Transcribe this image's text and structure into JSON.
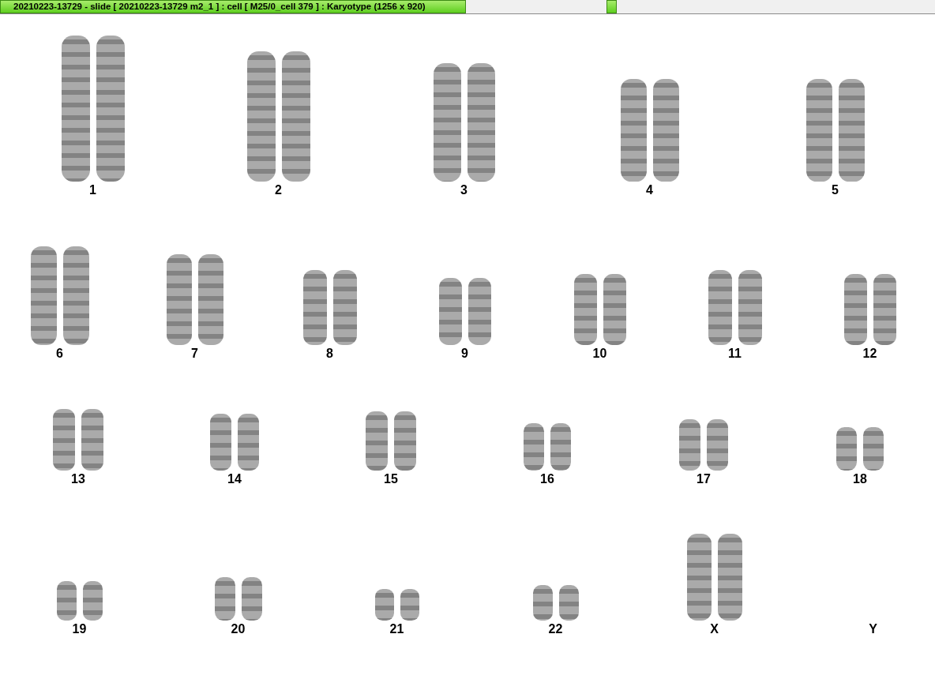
{
  "title_bar": {
    "title": "20210223-13729 - slide [ 20210223-13729 m2_1 ] : cell [ M25/0_cell 379 ] : Karyotype  (1256 x 920)"
  },
  "karyotype": {
    "chromosomes": [
      {
        "label": "1",
        "present": true
      },
      {
        "label": "2",
        "present": true
      },
      {
        "label": "3",
        "present": true
      },
      {
        "label": "4",
        "present": true
      },
      {
        "label": "5",
        "present": true
      },
      {
        "label": "6",
        "present": true
      },
      {
        "label": "7",
        "present": true
      },
      {
        "label": "8",
        "present": true
      },
      {
        "label": "9",
        "present": true
      },
      {
        "label": "10",
        "present": true
      },
      {
        "label": "11",
        "present": true
      },
      {
        "label": "12",
        "present": true
      },
      {
        "label": "13",
        "present": true
      },
      {
        "label": "14",
        "present": true
      },
      {
        "label": "15",
        "present": true
      },
      {
        "label": "16",
        "present": true
      },
      {
        "label": "17",
        "present": true
      },
      {
        "label": "18",
        "present": true
      },
      {
        "label": "19",
        "present": true
      },
      {
        "label": "20",
        "present": true
      },
      {
        "label": "21",
        "present": true
      },
      {
        "label": "22",
        "present": true
      },
      {
        "label": "X",
        "present": true
      },
      {
        "label": "Y",
        "present": false
      }
    ]
  }
}
